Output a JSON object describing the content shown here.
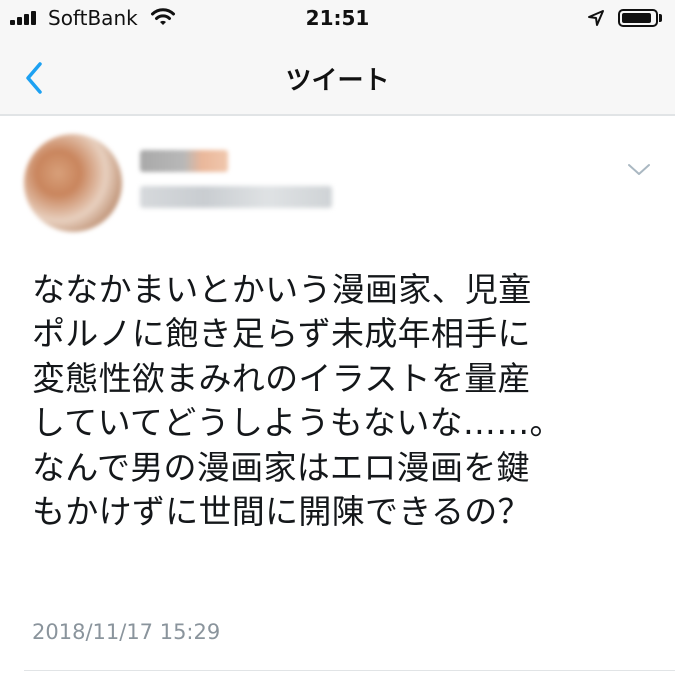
{
  "status_bar": {
    "carrier": "SoftBank",
    "time": "21:51",
    "battery_level": 0.9
  },
  "nav": {
    "title": "ツイート"
  },
  "tweet": {
    "text_lines": [
      "ななかまいとかいう漫画家、児童",
      "ポルノに飽き足らず未成年相手に",
      "変態性欲まみれのイラストを量産",
      "していてどうしようもないな……。",
      "なんで男の漫画家はエロ漫画を鍵",
      "もかけずに世間に開陳できるの？"
    ],
    "timestamp": "2018/11/17 15:29"
  },
  "icons": {
    "signal": "signal-bars-icon",
    "wifi": "wifi-icon",
    "location": "location-arrow-icon",
    "battery": "battery-icon",
    "back": "chevron-left-icon",
    "more": "chevron-down-icon"
  },
  "colors": {
    "accent": "#1da1f2",
    "text": "#14171a",
    "secondary_text": "#8a949c",
    "bar_background": "#f7f7f7"
  }
}
